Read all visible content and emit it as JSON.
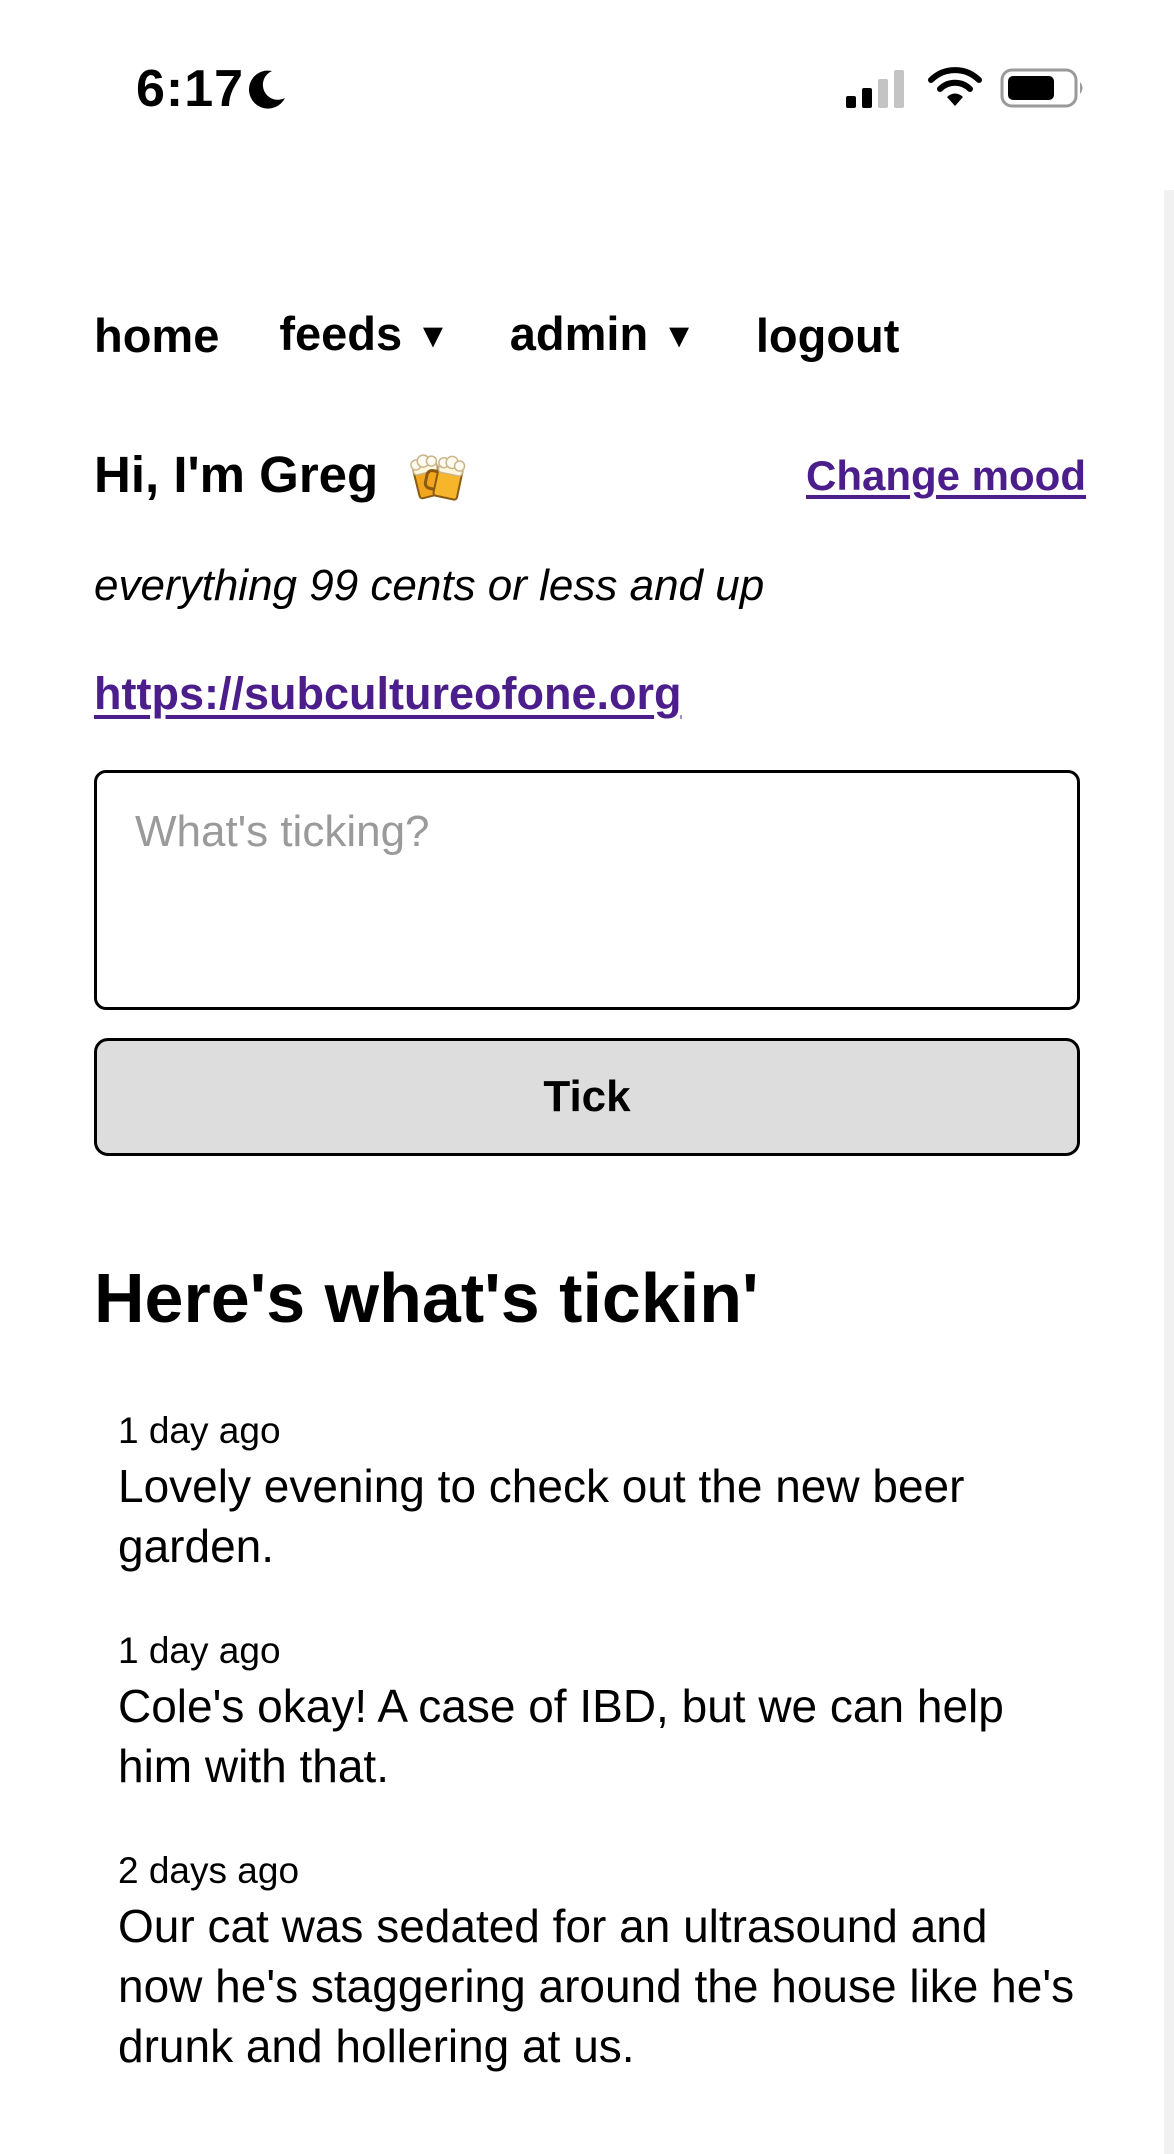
{
  "status_bar": {
    "time": "6:17",
    "icons": [
      "moon-icon",
      "signal-icon",
      "wifi-icon",
      "battery-icon"
    ]
  },
  "nav": {
    "items": [
      {
        "label": "home",
        "has_caret": false
      },
      {
        "label": "feeds",
        "has_caret": true
      },
      {
        "label": "admin",
        "has_caret": true
      },
      {
        "label": "logout",
        "has_caret": false
      }
    ],
    "caret_glyph": "▼"
  },
  "profile": {
    "greeting": "Hi, I'm Greg",
    "mood_icon": "beer-mugs-icon",
    "change_mood_label": "Change mood",
    "tagline": "everything 99 cents or less and up",
    "link": "https://subcultureofone.org"
  },
  "composer": {
    "placeholder": "What's ticking?",
    "value": "",
    "button_label": "Tick"
  },
  "feed": {
    "heading": "Here's what's tickin'",
    "items": [
      {
        "time": "1 day ago",
        "text": "Lovely evening to check out the new beer garden."
      },
      {
        "time": "1 day ago",
        "text": "Cole's okay! A case of IBD, but we can help him with that."
      },
      {
        "time": "2 days ago",
        "text": "Our cat was sedated for an ultrasound and now he's staggering around the house like he's drunk and hollering at us."
      }
    ]
  },
  "colors": {
    "link": "#4b1e8c",
    "button_bg": "#dddddd",
    "placeholder": "#9a9a9a"
  }
}
